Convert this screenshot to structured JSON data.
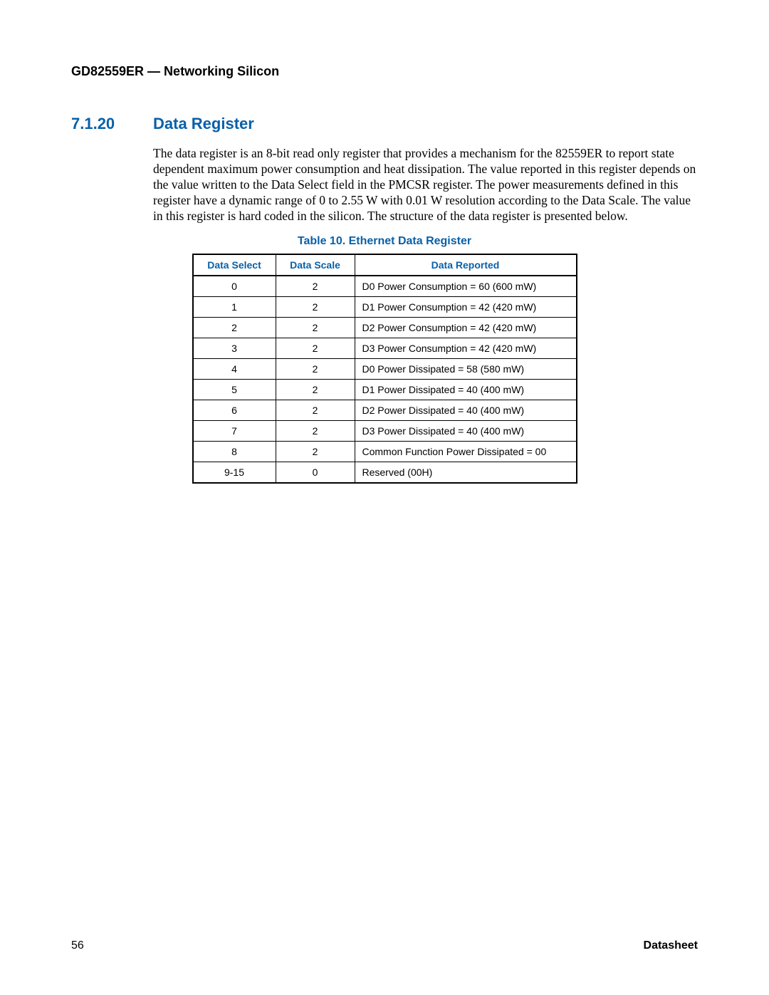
{
  "header": {
    "running_head": "GD82559ER — Networking Silicon"
  },
  "section": {
    "number": "7.1.20",
    "title": "Data Register",
    "paragraph": "The data register is an 8-bit read only register that provides a mechanism for the 82559ER to report state dependent maximum power consumption and heat dissipation. The value reported in this register depends on the value written to the Data Select field in the PMCSR register. The power measurements defined in this register have a dynamic range of 0 to 2.55 W with 0.01 W resolution according to the Data Scale. The value in this register is hard coded in the silicon. The structure of the data register is presented below."
  },
  "table": {
    "caption": "Table 10. Ethernet Data Register",
    "headers": {
      "select": "Data Select",
      "scale": "Data Scale",
      "reported": "Data Reported"
    },
    "rows": [
      {
        "select": "0",
        "scale": "2",
        "reported": "D0 Power Consumption = 60 (600 mW)"
      },
      {
        "select": "1",
        "scale": "2",
        "reported": "D1 Power Consumption = 42 (420 mW)"
      },
      {
        "select": "2",
        "scale": "2",
        "reported": "D2 Power Consumption = 42 (420 mW)"
      },
      {
        "select": "3",
        "scale": "2",
        "reported": "D3 Power Consumption = 42 (420 mW)"
      },
      {
        "select": "4",
        "scale": "2",
        "reported": "D0 Power Dissipated = 58 (580 mW)"
      },
      {
        "select": "5",
        "scale": "2",
        "reported": "D1 Power Dissipated = 40 (400 mW)"
      },
      {
        "select": "6",
        "scale": "2",
        "reported": "D2 Power Dissipated = 40 (400 mW)"
      },
      {
        "select": "7",
        "scale": "2",
        "reported": "D3 Power Dissipated = 40 (400 mW)"
      },
      {
        "select": "8",
        "scale": "2",
        "reported": "Common Function Power Dissipated = 00"
      },
      {
        "select": "9-15",
        "scale": "0",
        "reported": "Reserved (00H)"
      }
    ]
  },
  "footer": {
    "page_number": "56",
    "doc_type": "Datasheet"
  },
  "chart_data": {
    "type": "table",
    "title": "Table 10. Ethernet Data Register",
    "columns": [
      "Data Select",
      "Data Scale",
      "Data Reported"
    ],
    "rows": [
      [
        "0",
        "2",
        "D0 Power Consumption = 60 (600 mW)"
      ],
      [
        "1",
        "2",
        "D1 Power Consumption = 42 (420 mW)"
      ],
      [
        "2",
        "2",
        "D2 Power Consumption = 42 (420 mW)"
      ],
      [
        "3",
        "2",
        "D3 Power Consumption = 42 (420 mW)"
      ],
      [
        "4",
        "2",
        "D0 Power Dissipated = 58 (580 mW)"
      ],
      [
        "5",
        "2",
        "D1 Power Dissipated = 40 (400 mW)"
      ],
      [
        "6",
        "2",
        "D2 Power Dissipated = 40 (400 mW)"
      ],
      [
        "7",
        "2",
        "D3 Power Dissipated = 40 (400 mW)"
      ],
      [
        "8",
        "2",
        "Common Function Power Dissipated = 00"
      ],
      [
        "9-15",
        "0",
        "Reserved (00H)"
      ]
    ]
  }
}
